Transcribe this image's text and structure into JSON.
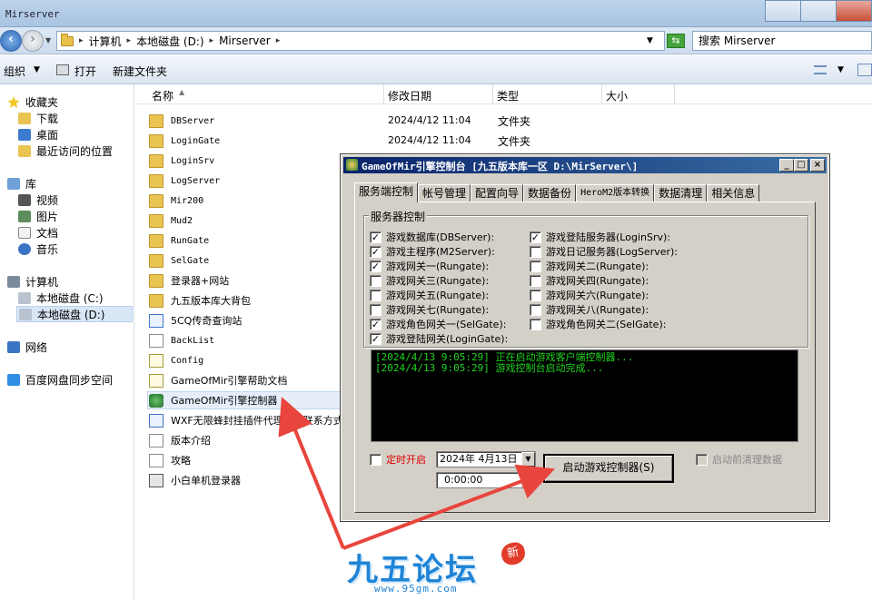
{
  "window": {
    "title": "Mirserver"
  },
  "address": {
    "crumbs": [
      "计算机",
      "本地磁盘 (D:)",
      "Mirserver"
    ],
    "search_placeholder": "搜索 Mirserver"
  },
  "toolbar": {
    "organize": "组织",
    "open": "打开",
    "new_folder": "新建文件夹"
  },
  "nav": {
    "favorites": "收藏夹",
    "downloads": "下载",
    "desktop": "桌面",
    "recent": "最近访问的位置",
    "library": "库",
    "videos": "视频",
    "pictures": "图片",
    "documents": "文档",
    "music": "音乐",
    "computer": "计算机",
    "drive_c": "本地磁盘 (C:)",
    "drive_d": "本地磁盘 (D:)",
    "network": "网络",
    "baidu": "百度网盘同步空间"
  },
  "columns": {
    "name": "名称",
    "date": "修改日期",
    "type": "类型",
    "size": "大小"
  },
  "files": [
    {
      "name": "DBServer",
      "date": "2024/4/12 11:04",
      "type": "文件夹"
    },
    {
      "name": "LoginGate",
      "date": "2024/4/12 11:04",
      "type": "文件夹"
    },
    {
      "name": "LoginSrv"
    },
    {
      "name": "LogServer"
    },
    {
      "name": "Mir200"
    },
    {
      "name": "Mud2"
    },
    {
      "name": "RunGate"
    },
    {
      "name": "SelGate"
    },
    {
      "name": "登录器+网站"
    },
    {
      "name": "九五版本库大背包"
    },
    {
      "name": "5CQ传奇查询站"
    },
    {
      "name": "BackList"
    },
    {
      "name": "Config"
    },
    {
      "name": "GameOfMir引擎帮助文档"
    },
    {
      "name": "GameOfMir引擎控制器"
    },
    {
      "name": "WXF无限蜂封挂插件代理购买联系方式"
    },
    {
      "name": "版本介绍"
    },
    {
      "name": "攻略"
    },
    {
      "name": "小白单机登录器"
    }
  ],
  "dialog": {
    "title": "GameOfMir引擎控制台 [九五版本库一区 D:\\MirServer\\]",
    "tabs": [
      "服务端控制",
      "帐号管理",
      "配置向导",
      "数据备份",
      "HeroM2版本转换",
      "数据清理",
      "相关信息"
    ],
    "group_title": "服务器控制",
    "left_checks": [
      {
        "label": "游戏数据库(DBServer):",
        "checked": true
      },
      {
        "label": "游戏主程序(M2Server):",
        "checked": true
      },
      {
        "label": "游戏网关一(Rungate):",
        "checked": true
      },
      {
        "label": "游戏网关三(Rungate):",
        "checked": false
      },
      {
        "label": "游戏网关五(Rungate):",
        "checked": false
      },
      {
        "label": "游戏网关七(Rungate):",
        "checked": false
      },
      {
        "label": "游戏角色网关一(SelGate):",
        "checked": true
      },
      {
        "label": "游戏登陆网关(LoginGate):",
        "checked": true
      }
    ],
    "right_checks": [
      {
        "label": "游戏登陆服务器(LoginSrv):",
        "checked": true
      },
      {
        "label": "游戏日记服务器(LogServer):",
        "checked": false
      },
      {
        "label": "游戏网关二(Rungate):",
        "checked": false
      },
      {
        "label": "游戏网关四(Rungate):",
        "checked": false
      },
      {
        "label": "游戏网关六(Rungate):",
        "checked": false
      },
      {
        "label": "游戏网关八(Rungate):",
        "checked": false
      },
      {
        "label": "游戏角色网关二(SelGate):",
        "checked": false
      }
    ],
    "log": [
      "[2024/4/13 9:05:29] 正在启动游戏客户端控制器...",
      "[2024/4/13 9:05:29] 游戏控制台启动完成..."
    ],
    "timer_label": "定时开启",
    "date_value": "2024年 4月13日",
    "time_value": "0:00:00",
    "start_button": "启动游戏控制器(S)",
    "clear_label": "启动前清理数据"
  },
  "watermark": {
    "text": "九五论坛",
    "badge": "新",
    "url": "www.95gm.com"
  },
  "colors": {
    "dialog_title": "#0a246a",
    "console_text": "#1fd51f",
    "annotation": "#e8453c"
  }
}
